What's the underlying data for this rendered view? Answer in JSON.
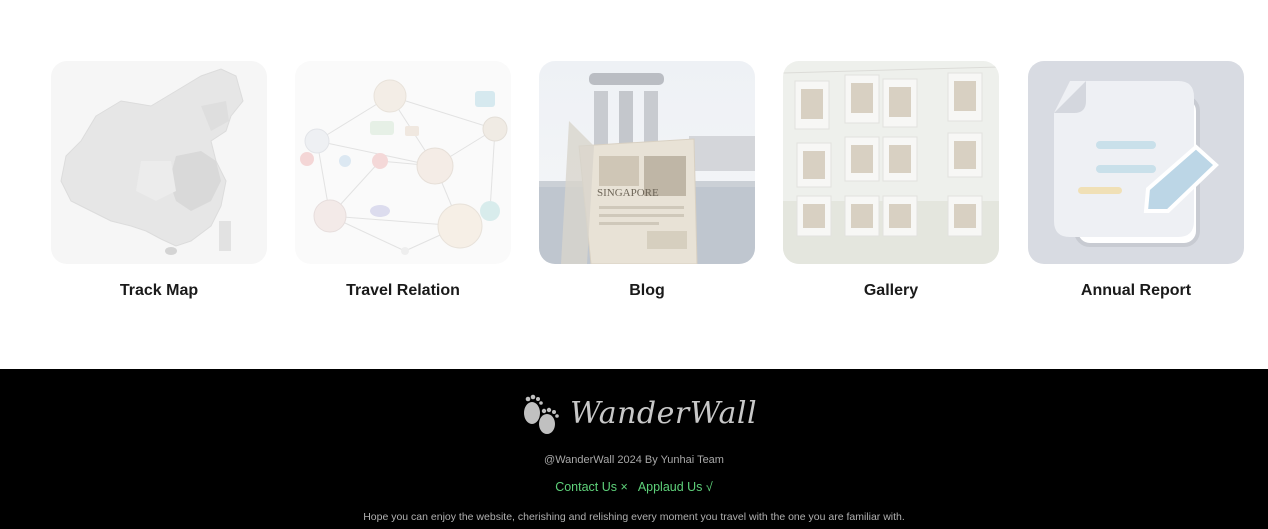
{
  "cards": [
    {
      "label": "Track Map",
      "icon": "china-map-illustration"
    },
    {
      "label": "Travel Relation",
      "icon": "social-network-illustration"
    },
    {
      "label": "Blog",
      "icon": "singapore-blog-photo"
    },
    {
      "label": "Gallery",
      "icon": "photo-wall-gallery"
    },
    {
      "label": "Annual Report",
      "icon": "document-edit-icon"
    }
  ],
  "footer": {
    "brand_name": "WanderWall",
    "brand_icon": "footprints-icon",
    "copyright": "@WanderWall 2024 By Yunhai Team",
    "contact_label": "Contact Us ×",
    "applaud_label": "Applaud Us √",
    "tagline": "Hope you can enjoy the website, cherishing and relishing every moment you travel with the one you are familiar with.",
    "background_color": "#000000",
    "link_color": "#5ed17a"
  }
}
